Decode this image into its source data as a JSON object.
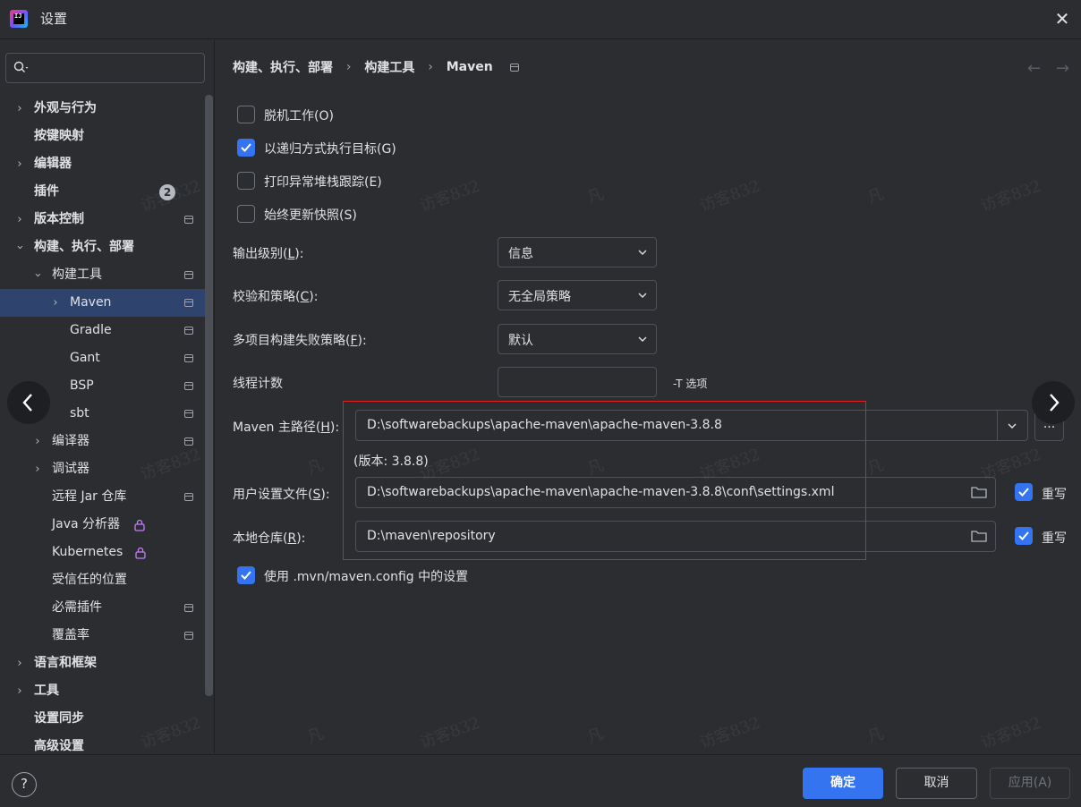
{
  "window": {
    "title": "设置",
    "close_glyph": "✕"
  },
  "sidebar": {
    "search_placeholder": "",
    "badge_count": "2",
    "items": [
      {
        "label": "外观与行为",
        "expandable": true
      },
      {
        "label": "按键映射"
      },
      {
        "label": "编辑器",
        "expandable": true
      },
      {
        "label": "插件"
      },
      {
        "label": "版本控制",
        "expandable": true
      },
      {
        "label": "构建、执行、部署",
        "expanded": true
      },
      {
        "label": "构建工具",
        "expanded": true
      },
      {
        "label": "Maven",
        "expandable": true,
        "selected": true
      },
      {
        "label": "Gradle"
      },
      {
        "label": "Gant"
      },
      {
        "label": "BSP"
      },
      {
        "label": "sbt"
      },
      {
        "label": "编译器",
        "expandable": true
      },
      {
        "label": "调试器",
        "expandable": true
      },
      {
        "label": "远程 Jar 仓库"
      },
      {
        "label": "Java 分析器"
      },
      {
        "label": "Kubernetes"
      },
      {
        "label": "受信任的位置"
      },
      {
        "label": "必需插件"
      },
      {
        "label": "覆盖率"
      },
      {
        "label": "语言和框架",
        "expandable": true
      },
      {
        "label": "工具",
        "expandable": true
      },
      {
        "label": "设置同步"
      },
      {
        "label": "高级设置"
      }
    ]
  },
  "breadcrumb": [
    "构建、执行、部署",
    "构建工具",
    "Maven"
  ],
  "breadcrumb_sep": "›",
  "nav": {
    "back": "←",
    "forward": "→"
  },
  "options": {
    "offline": {
      "label": "脱机工作(O)",
      "checked": false
    },
    "recursive": {
      "label": "以递归方式执行目标(G)",
      "checked": true
    },
    "stacktrace": {
      "label": "打印异常堆栈跟踪(E)",
      "checked": false
    },
    "snapshots": {
      "label": "始终更新快照(S)",
      "checked": false
    }
  },
  "fields": {
    "output_level": {
      "label_pre": "输出级别(",
      "mnemonic": "L",
      "label_post": "):",
      "value": "信息"
    },
    "checksum": {
      "label_pre": "校验和策略(",
      "mnemonic": "C",
      "label_post": "):",
      "value": "无全局策略"
    },
    "multiproject": {
      "label_pre": "多项目构建失败策略(",
      "mnemonic": "F",
      "label_post": "):",
      "value": "默认"
    },
    "threads": {
      "label": "线程计数",
      "value": "",
      "hint": "-T 选项"
    },
    "maven_home": {
      "label_pre": "Maven 主路径(",
      "mnemonic": "H",
      "label_post": "):",
      "value": "D:\\softwarebackups\\apache-maven\\apache-maven-3.8.8",
      "version": "(版本: 3.8.8)",
      "browse": "..."
    },
    "user_settings": {
      "label_pre": "用户设置文件(",
      "mnemonic": "S",
      "label_post": "):",
      "value": "D:\\softwarebackups\\apache-maven\\apache-maven-3.8.8\\conf\\settings.xml",
      "override_label": "重写",
      "override": true
    },
    "local_repo": {
      "label_pre": "本地仓库(",
      "mnemonic": "R",
      "label_post": "):",
      "value": "D:\\maven\\repository",
      "override_label": "重写",
      "override": true
    }
  },
  "use_mvn_config": {
    "label": "使用 .mvn/maven.config 中的设置",
    "checked": true
  },
  "footer": {
    "help": "?",
    "ok": "确定",
    "cancel": "取消",
    "apply": "应用(A)"
  },
  "watermarks": [
    "访客832",
    "凡"
  ],
  "colors": {
    "accent": "#3574f0",
    "selection": "#2e436e",
    "background": "#2b2d30",
    "highlight_box": "#e02020"
  }
}
